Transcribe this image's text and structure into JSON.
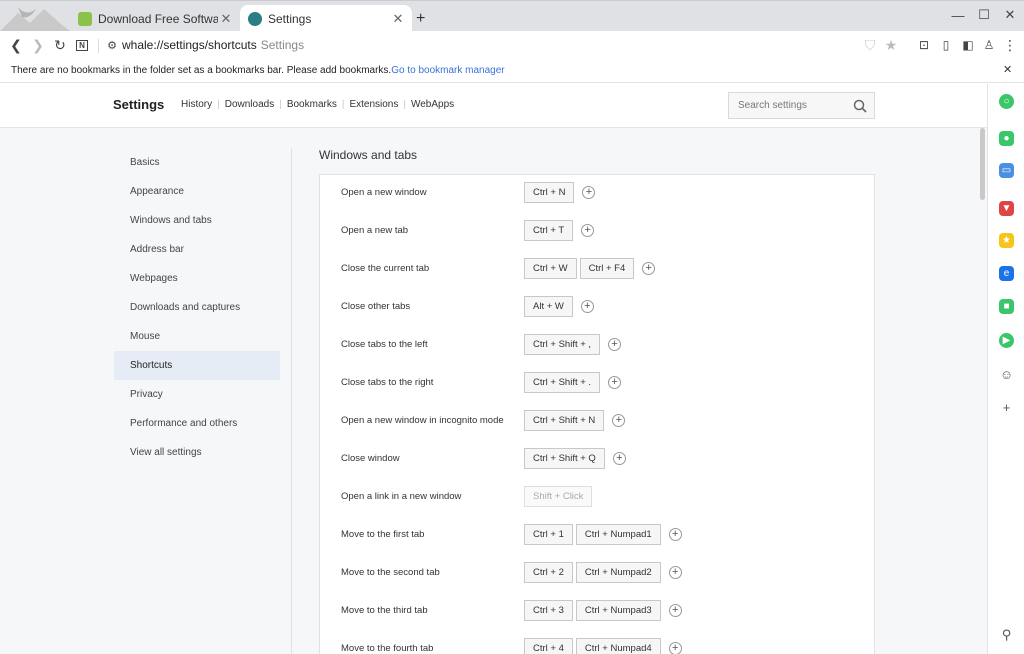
{
  "tabs": [
    {
      "title": "Download Free Software for W",
      "favicon_color": "#8bc34a"
    },
    {
      "title": "Settings",
      "favicon_color": "#2a7f86"
    }
  ],
  "new_tab_icon": "plus-icon",
  "window_controls": [
    "minimize-icon",
    "maximize-icon",
    "close-icon"
  ],
  "address_bar": {
    "url": "whale://settings/shortcuts",
    "page_title": "Settings"
  },
  "bookmarks_bar": {
    "message": "There are no bookmarks in the folder set as a bookmarks bar. Please add bookmarks.",
    "link": "Go to bookmark manager"
  },
  "header": {
    "title": "Settings",
    "nav": [
      "History",
      "Downloads",
      "Bookmarks",
      "Extensions",
      "WebApps"
    ],
    "search_placeholder": "Search settings"
  },
  "sidebar": {
    "items": [
      {
        "label": "Basics"
      },
      {
        "label": "Appearance"
      },
      {
        "label": "Windows and tabs"
      },
      {
        "label": "Address bar"
      },
      {
        "label": "Webpages"
      },
      {
        "label": "Downloads and captures"
      },
      {
        "label": "Mouse"
      },
      {
        "label": "Shortcuts",
        "active": true
      },
      {
        "label": "Privacy"
      },
      {
        "label": "Performance and others"
      },
      {
        "label": "View all settings"
      }
    ]
  },
  "section": {
    "title": "Windows and tabs",
    "shortcuts": [
      {
        "label": "Open a new window",
        "keys": [
          "Ctrl + N"
        ],
        "addable": true
      },
      {
        "label": "Open a new tab",
        "keys": [
          "Ctrl + T"
        ],
        "addable": true
      },
      {
        "label": "Close the current tab",
        "keys": [
          "Ctrl + W",
          "Ctrl + F4"
        ],
        "addable": true
      },
      {
        "label": "Close other tabs",
        "keys": [
          "Alt + W"
        ],
        "addable": true
      },
      {
        "label": "Close tabs to the left",
        "keys": [
          "Ctrl + Shift + ,"
        ],
        "addable": true
      },
      {
        "label": "Close tabs to the right",
        "keys": [
          "Ctrl + Shift + ."
        ],
        "addable": true
      },
      {
        "label": "Open a new window in incognito mode",
        "keys": [
          "Ctrl + Shift + N"
        ],
        "addable": true
      },
      {
        "label": "Close window",
        "keys": [
          "Ctrl + Shift + Q"
        ],
        "addable": true
      },
      {
        "label": "Open a link in a new window",
        "keys": [
          "Shift + Click"
        ],
        "addable": false,
        "disabled": true
      },
      {
        "label": "Move to the first tab",
        "keys": [
          "Ctrl + 1",
          "Ctrl + Numpad1"
        ],
        "addable": true
      },
      {
        "label": "Move to the second tab",
        "keys": [
          "Ctrl + 2",
          "Ctrl + Numpad2"
        ],
        "addable": true
      },
      {
        "label": "Move to the third tab",
        "keys": [
          "Ctrl + 3",
          "Ctrl + Numpad3"
        ],
        "addable": true
      },
      {
        "label": "Move to the fourth tab",
        "keys": [
          "Ctrl + 4",
          "Ctrl + Numpad4"
        ],
        "addable": true
      }
    ]
  },
  "right_sidebar_icons": [
    {
      "name": "whale-space-icon",
      "color": "#3cc66a"
    },
    {
      "name": "notification-icon",
      "color": "#3cc66a"
    },
    {
      "name": "wallet-icon",
      "color": "#4a90e2"
    },
    {
      "name": "pocket-icon",
      "color": "#e04545"
    },
    {
      "name": "favorites-icon",
      "color": "#f5c518"
    },
    {
      "name": "translate-icon",
      "color": "#1a73e8"
    },
    {
      "name": "sidebar-app-icon",
      "color": "#3cc66a"
    },
    {
      "name": "media-play-icon",
      "color": "#3cc66a"
    },
    {
      "name": "profile-app-icon",
      "color": "#555555"
    },
    {
      "name": "add-app-icon",
      "color": "#555555"
    },
    {
      "name": "pin-icon",
      "color": "#555555"
    }
  ]
}
